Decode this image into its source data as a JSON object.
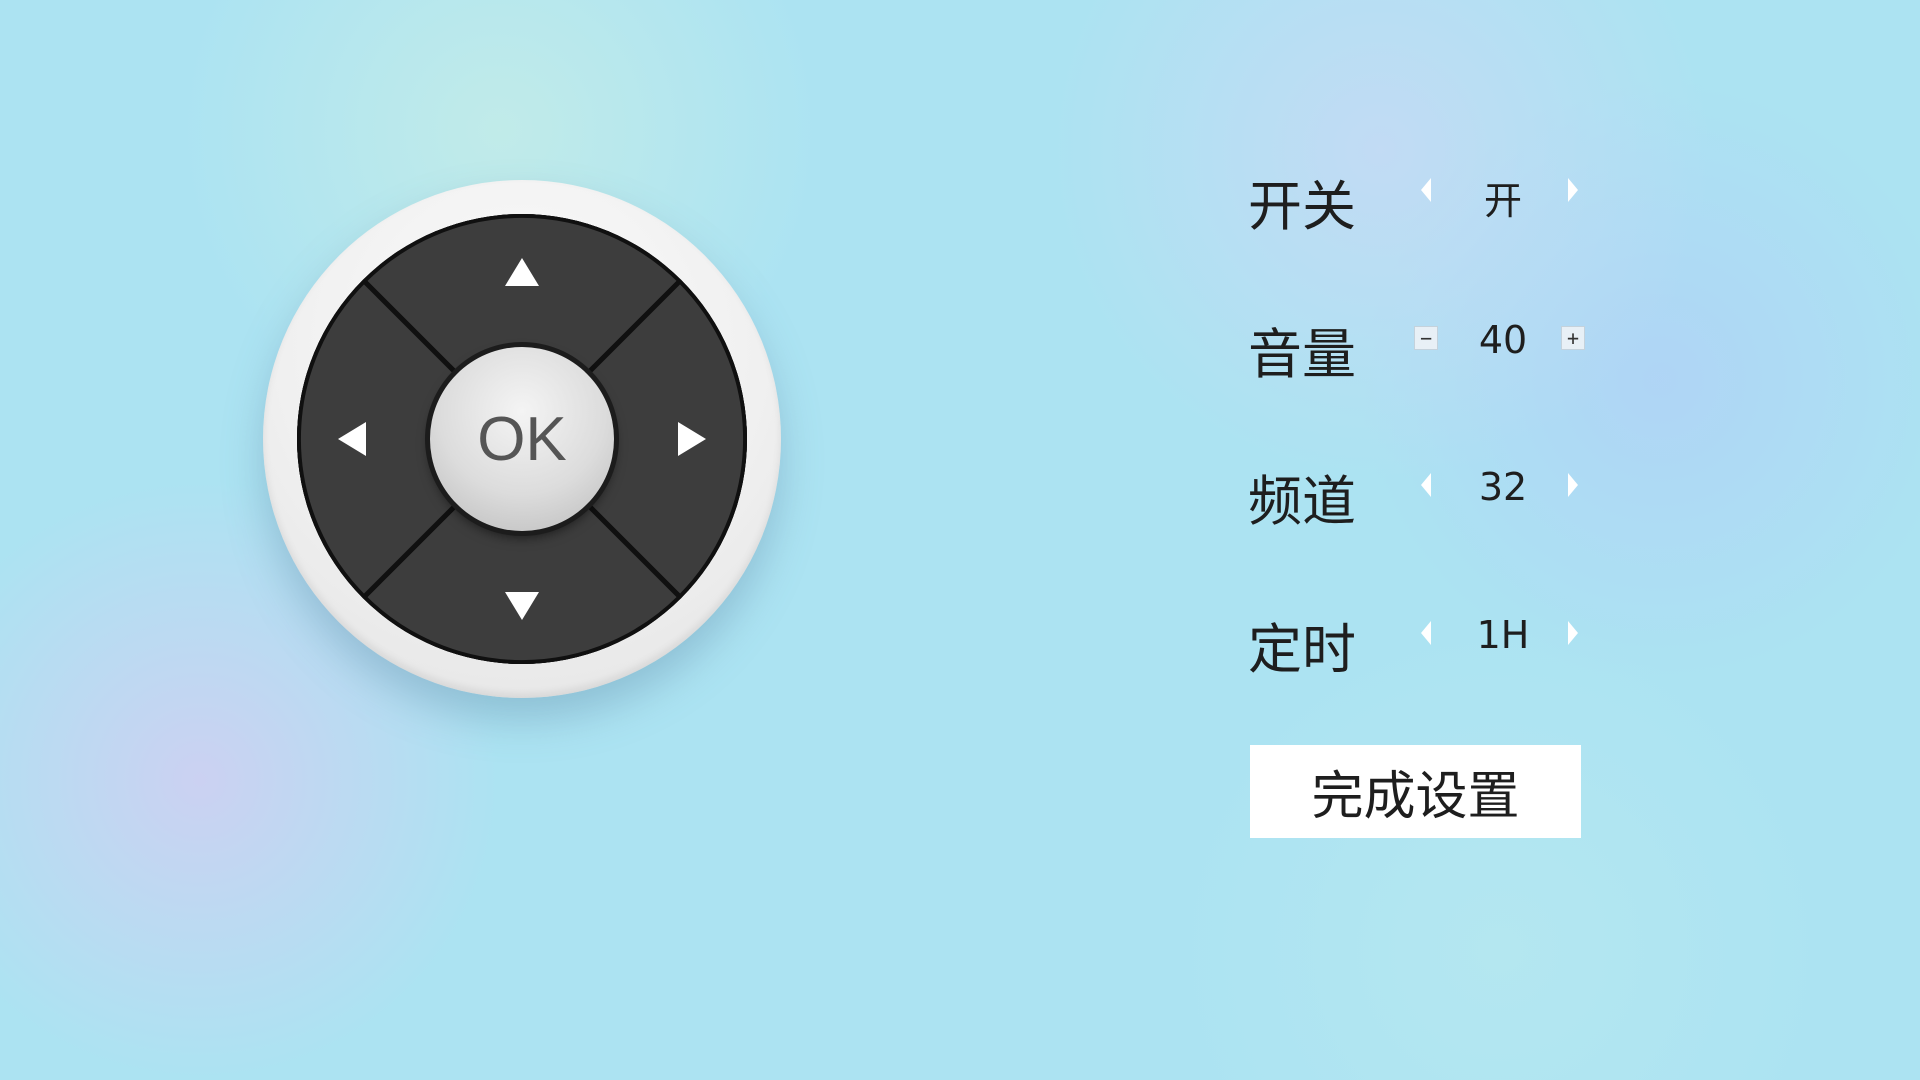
{
  "remote": {
    "ok_label": "OK",
    "buttons": [
      "up",
      "down",
      "left",
      "right",
      "ok"
    ]
  },
  "settings": {
    "rows": [
      {
        "label": "开关",
        "value": "开",
        "control": "arrows"
      },
      {
        "label": "音量",
        "value": "40",
        "control": "stepper"
      },
      {
        "label": "频道",
        "value": "32",
        "control": "arrows"
      },
      {
        "label": "定时",
        "value": "1H",
        "control": "arrows"
      }
    ],
    "stepper": {
      "minus": "−",
      "plus": "+"
    },
    "done_label": "完成设置"
  },
  "icons": {
    "up": "arrow-up-icon",
    "down": "arrow-down-icon",
    "left": "arrow-left-icon",
    "right": "arrow-right-icon"
  },
  "colors": {
    "background": "#ace3f2",
    "pad": "#141414",
    "segment": "#3b3b3b",
    "ok": "#d8d8d8",
    "text": "#1e1e1e"
  }
}
